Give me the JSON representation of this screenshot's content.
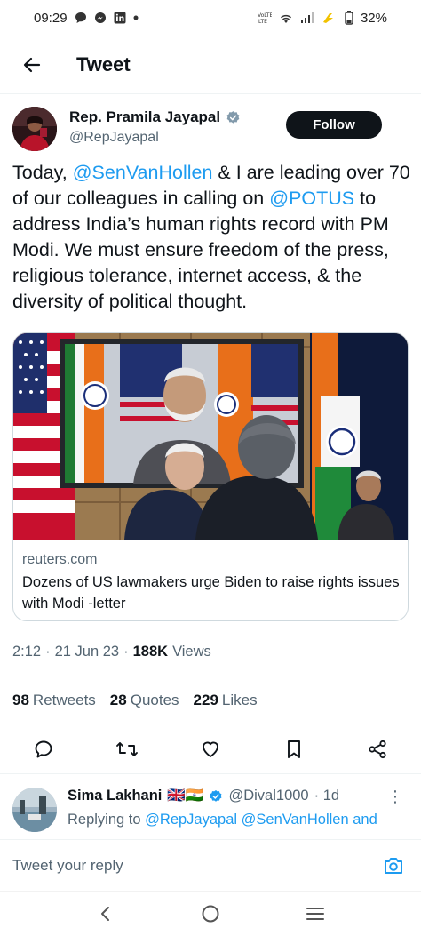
{
  "status_bar": {
    "time": "09:29",
    "battery": "32%",
    "notification_icons": [
      "chat-bubble-icon",
      "messenger-icon",
      "linkedin-icon",
      "dot-icon"
    ],
    "system_icons": [
      "volte-icon",
      "wifi-icon",
      "signal-icon",
      "charging-icon",
      "battery-icon"
    ]
  },
  "header": {
    "back_icon": "arrow-left-icon",
    "title": "Tweet"
  },
  "tweet": {
    "author_name": "Rep. Pramila Jayapal",
    "author_handle": "@RepJayapal",
    "verified": true,
    "follow_label": "Follow",
    "text_segments": {
      "p1": "Today, ",
      "m1": "@SenVanHollen",
      "p2": " & I are leading over 70 of our colleagues in calling on ",
      "m2": "@POTUS",
      "p3": " to address India’s human rights record with PM Modi. We must ensure freedom of the press, religious tolerance, internet access, & the diversity of political thought."
    },
    "card": {
      "domain": "reuters.com",
      "headline": "Dozens of US lawmakers urge Biden to raise rights issues with Modi -letter"
    },
    "time": "2:12",
    "date": "21 Jun 23",
    "views_count": "188K",
    "views_label": "Views",
    "separator": "·",
    "stats": {
      "retweets_count": "98",
      "retweets_label": "Retweets",
      "quotes_count": "28",
      "quotes_label": "Quotes",
      "likes_count": "229",
      "likes_label": "Likes"
    },
    "action_icons": [
      "reply-icon",
      "retweet-icon",
      "like-icon",
      "bookmark-icon",
      "share-icon"
    ]
  },
  "reply": {
    "name": "Sima Lakhani",
    "flags": "🇬🇧🇮🇳",
    "verified": true,
    "handle": "@Dival1000",
    "time": "· 1d",
    "more": "⋮",
    "replying_prefix": "Replying to",
    "replying_to": "@RepJayapal @SenVanHollen and"
  },
  "compose": {
    "placeholder": "Tweet your reply",
    "camera_icon": "camera-icon"
  },
  "nav_bar": {
    "icons": [
      "nav-back-icon",
      "nav-home-icon",
      "nav-recents-icon"
    ]
  },
  "colors": {
    "accent": "#1d9bf0",
    "text": "#0f1419",
    "secondary": "#536471",
    "border": "#cfd9de"
  }
}
